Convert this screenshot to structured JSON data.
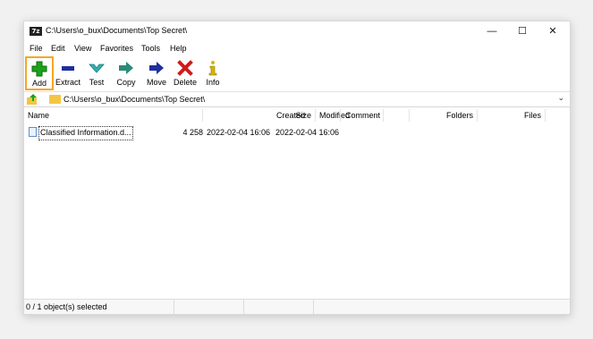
{
  "window": {
    "app_icon_text": "7z",
    "title": "C:\\Users\\o_bux\\Documents\\Top Secret\\",
    "minimize_glyph": "—",
    "maximize_glyph": "☐",
    "close_glyph": "✕"
  },
  "menu": [
    "File",
    "Edit",
    "View",
    "Favorites",
    "Tools",
    "Help"
  ],
  "toolbar": {
    "add": {
      "label": "Add",
      "icon": "plus-icon",
      "color": "#1aa31a",
      "highlighted": true,
      "highlight_color": "#f5a623"
    },
    "extract": {
      "label": "Extract",
      "icon": "minus-icon",
      "color": "#1f2f9e"
    },
    "test": {
      "label": "Test",
      "icon": "check-chevron-icon",
      "color": "#2fb3b3"
    },
    "copy": {
      "label": "Copy",
      "icon": "arrow-right-icon",
      "color": "#2b8a7a"
    },
    "move": {
      "label": "Move",
      "icon": "arrow-right-icon",
      "color": "#1f2f9e"
    },
    "delete": {
      "label": "Delete",
      "icon": "x-icon",
      "color": "#d11a1a"
    },
    "info": {
      "label": "Info",
      "icon": "info-icon",
      "color": "#d9b400"
    }
  },
  "address": {
    "path": "C:\\Users\\o_bux\\Documents\\Top Secret\\",
    "dropdown_glyph": "⌄"
  },
  "columns": {
    "name": "Name",
    "size": "Size",
    "modified": "Modified",
    "created": "Created",
    "comment": "Comment",
    "folders": "Folders",
    "files": "Files"
  },
  "files": [
    {
      "name": "Classified Information.d...",
      "size": "4 258",
      "modified": "2022-02-04 16:06",
      "created": "2022-02-04 16:06",
      "comment": "",
      "folders": "",
      "files": ""
    }
  ],
  "status": {
    "selection": "0 / 1 object(s) selected"
  }
}
